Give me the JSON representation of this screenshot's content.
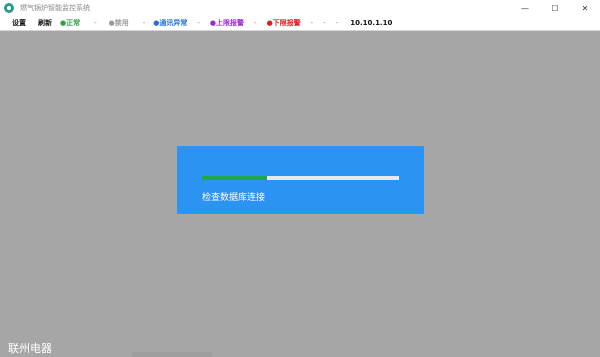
{
  "window": {
    "title": "燃气锅炉智能监控系统",
    "controls": {
      "minimize": "—",
      "maximize": "☐",
      "close": "✕"
    }
  },
  "menu": {
    "items": [
      "设置",
      "刷新"
    ],
    "statuses": [
      {
        "label": "●正常",
        "color": "#2ea043"
      },
      {
        "label": "●禁用",
        "color": "#9a9a9a"
      },
      {
        "label": "●通讯异常",
        "color": "#1f6fd6"
      },
      {
        "label": "●上限报警",
        "color": "#9b2bd6"
      },
      {
        "label": "●下限报警",
        "color": "#e21b1b"
      }
    ],
    "separators": [
      "-",
      "-",
      "-",
      "-",
      "-",
      "-",
      "-"
    ],
    "ip": "10.10.1.10"
  },
  "dialog": {
    "progress": 0.33,
    "message": "检查数据库连接",
    "bg_color": "#2b94f3",
    "fill_color": "#1ea84a"
  },
  "footer": {
    "brand": "联州电器"
  }
}
